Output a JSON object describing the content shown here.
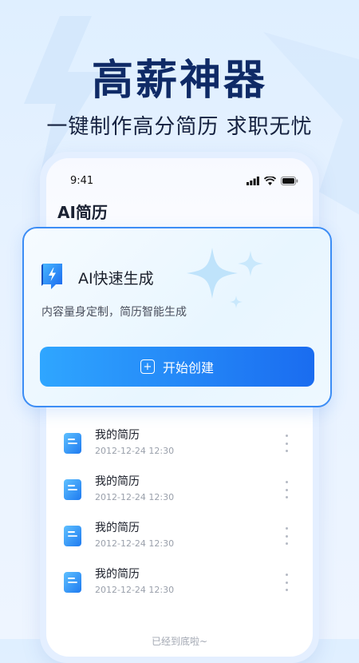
{
  "hero": {
    "title": "高薪神器",
    "subtitle": "一键制作高分简历 求职无忧"
  },
  "phone": {
    "status_time": "9:41",
    "app_title": "AI简历"
  },
  "feature_card": {
    "title": "AI快速生成",
    "description": "内容量身定制，简历智能生成",
    "button_label": "开始创建"
  },
  "resumes": [
    {
      "title": "我的简历",
      "time": "2012-12-24 12:30"
    },
    {
      "title": "我的简历",
      "time": "2012-12-24 12:30"
    },
    {
      "title": "我的简历",
      "time": "2012-12-24 12:30"
    },
    {
      "title": "我的简历",
      "time": "2012-12-24 12:30"
    }
  ],
  "list_end_text": "已经到底啦~",
  "colors": {
    "accent": "#1a6cf0",
    "accent_light": "#2fa6ff",
    "title": "#0f2a66"
  }
}
